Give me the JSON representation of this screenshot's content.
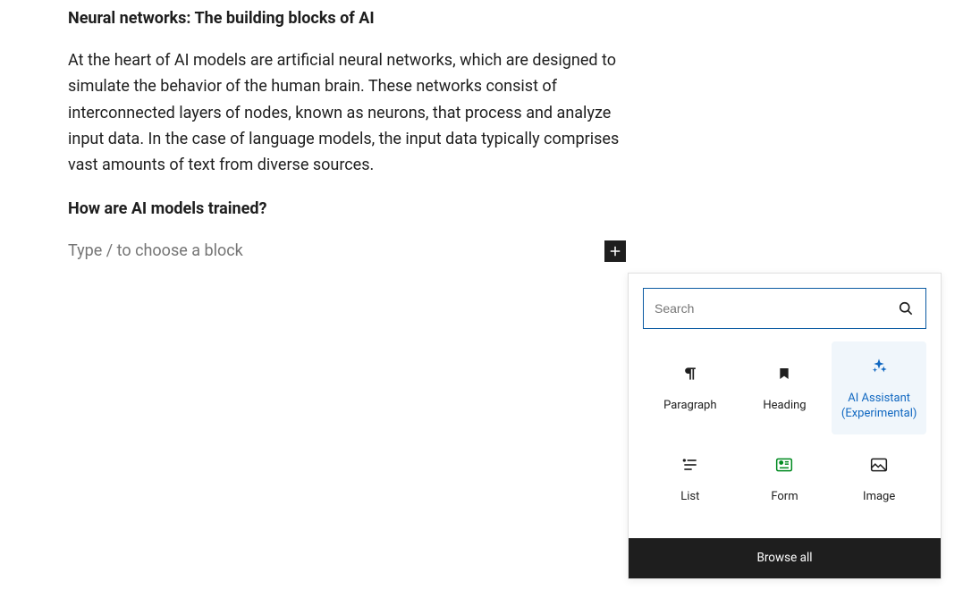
{
  "content": {
    "heading1": "Neural networks: The building blocks of AI",
    "paragraph1": "At the heart of AI models are artificial neural networks, which are designed to simulate the behavior of the human brain. These networks consist of interconnected layers of nodes, known as neurons, that process and analyze input data. In the case of language models, the input data typically comprises vast amounts of text from diverse sources.",
    "heading2": "How are AI models trained?",
    "placeholder": "Type / to choose a block"
  },
  "inserter": {
    "search_placeholder": "Search",
    "blocks": [
      {
        "label": "Paragraph"
      },
      {
        "label": "Heading"
      },
      {
        "label": "AI Assistant (Experimental)"
      },
      {
        "label": "List"
      },
      {
        "label": "Form"
      },
      {
        "label": "Image"
      }
    ],
    "browse_all": "Browse all"
  }
}
